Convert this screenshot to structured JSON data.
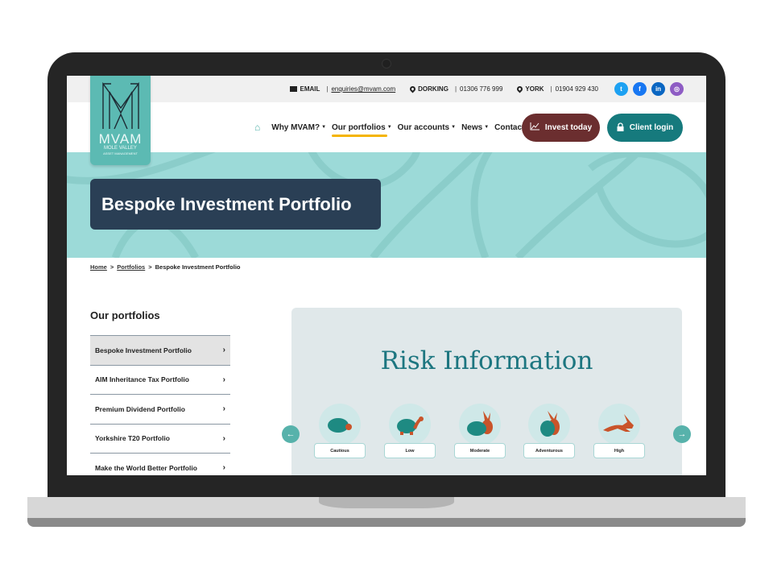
{
  "topbar": {
    "email_label": "EMAIL",
    "email_value": "enquiries@mvam.com",
    "dorking_label": "DORKING",
    "dorking_phone": "01306 776 999",
    "york_label": "YORK",
    "york_phone": "01904 929 430",
    "social": [
      {
        "name": "twitter",
        "glyph": "t",
        "color": "#1da1f2"
      },
      {
        "name": "facebook",
        "glyph": "f",
        "color": "#1877f2"
      },
      {
        "name": "linkedin",
        "glyph": "in",
        "color": "#0a66c2"
      },
      {
        "name": "instagram",
        "glyph": "◎",
        "color": "#8e5cc4"
      }
    ]
  },
  "logo": {
    "main": "MVAM",
    "sub1": "MOLE VALLEY",
    "sub2": "ASSET MANAGEMENT"
  },
  "nav": {
    "items": [
      {
        "label": "Why MVAM?",
        "dropdown": true
      },
      {
        "label": "Our portfolios",
        "dropdown": true,
        "active": true
      },
      {
        "label": "Our accounts",
        "dropdown": true
      },
      {
        "label": "News",
        "dropdown": true
      },
      {
        "label": "Contact",
        "dropdown": false
      }
    ],
    "invest_label": "Invest today",
    "login_label": "Client login"
  },
  "hero": {
    "title": "Bespoke Investment Portfolio"
  },
  "breadcrumb": {
    "home": "Home",
    "portfolios": "Portfolios",
    "current": "Bespoke Investment Portfolio",
    "sep": ">"
  },
  "sidebar": {
    "title": "Our portfolios",
    "items": [
      {
        "label": "Bespoke Investment Portfolio",
        "active": true
      },
      {
        "label": "AIM Inheritance Tax Portfolio"
      },
      {
        "label": "Premium Dividend Portfolio"
      },
      {
        "label": "Yorkshire T20 Portfolio"
      },
      {
        "label": "Make the World Better Portfolio"
      }
    ]
  },
  "risk": {
    "title": "Risk Information",
    "levels": [
      "Cautious",
      "Low",
      "Moderate",
      "Adventurous",
      "High"
    ],
    "prev_icon": "arrow-left-icon",
    "next_icon": "arrow-right-icon"
  },
  "colors": {
    "teal": "#5cbab3",
    "navy": "#2a3f55",
    "maroon": "#6b2e2f",
    "dark_teal": "#167a7d",
    "accent_yellow": "#f4b400"
  }
}
